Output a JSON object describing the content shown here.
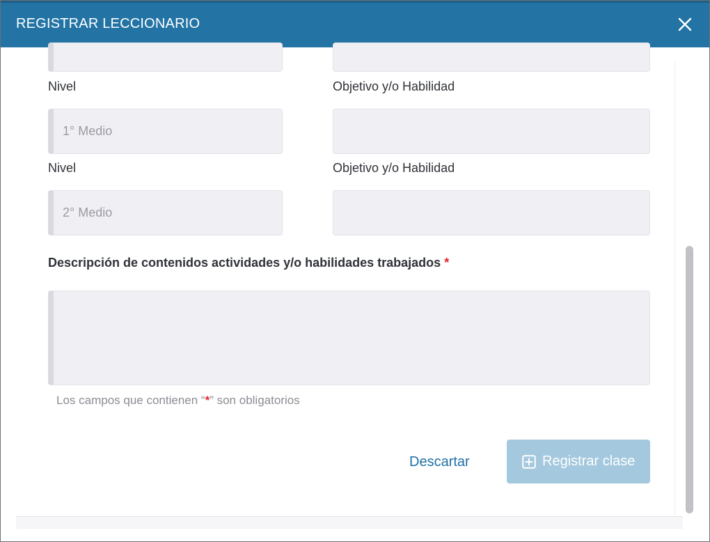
{
  "modal": {
    "title": "REGISTRAR LECCIONARIO"
  },
  "rows": [
    {
      "nivel_label": "Nivel",
      "nivel_value": "1° Medio",
      "objetivo_label": "Objetivo y/o Habilidad",
      "objetivo_value": ""
    },
    {
      "nivel_label": "Nivel",
      "nivel_value": "2° Medio",
      "objetivo_label": "Objetivo y/o Habilidad",
      "objetivo_value": ""
    }
  ],
  "description": {
    "label": "Descripción de contenidos actividades y/o habilidades trabajados",
    "required_mark": "*",
    "value": ""
  },
  "hint": {
    "before": "Los campos que contienen “",
    "mark": "*",
    "after": "” son obligatorios"
  },
  "actions": {
    "discard_label": "Descartar",
    "register_label": "Registrar clase"
  },
  "colors": {
    "header": "#2374a5",
    "primary_disabled": "#a4c8de",
    "link": "#1f6fa5",
    "required": "#e0242f"
  },
  "icons": {
    "close": "close-icon",
    "register": "plus-square-icon"
  }
}
